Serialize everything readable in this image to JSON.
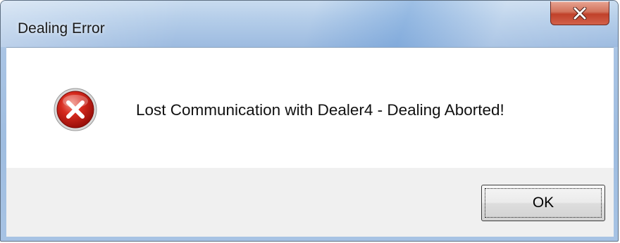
{
  "window": {
    "title": "Dealing Error",
    "close_icon": "close-icon"
  },
  "dialog": {
    "icon": "error-icon",
    "message": "Lost Communication with Dealer4  -  Dealing Aborted!"
  },
  "buttons": {
    "ok_label": "OK"
  },
  "colors": {
    "title_bar": "#a9c4e4",
    "close_button": "#c0412a",
    "error_icon_red": "#c41a16",
    "button_area": "#f0f0f0"
  }
}
